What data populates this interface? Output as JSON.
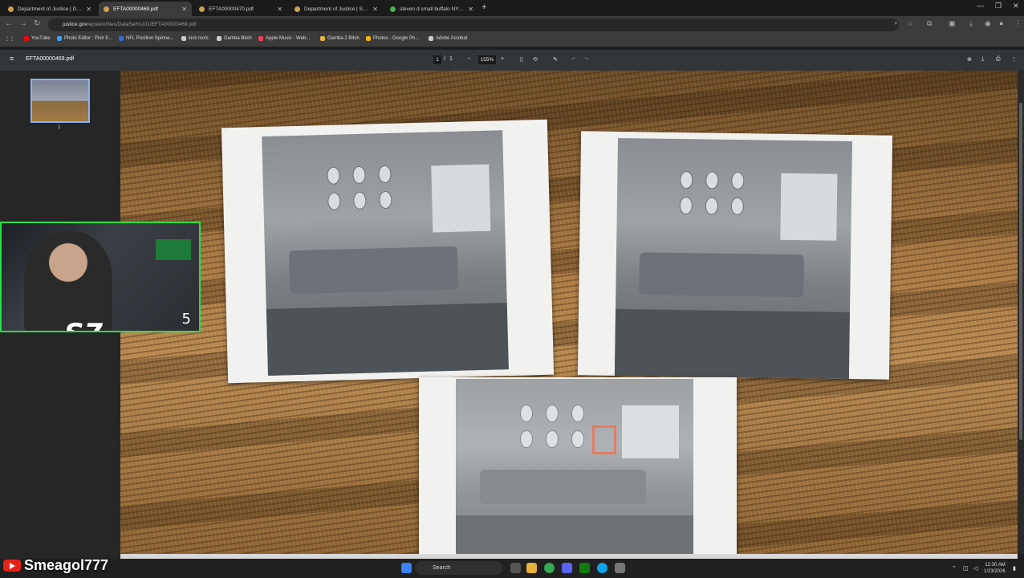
{
  "browser": {
    "tabs": [
      {
        "title": "Department of Justice | Data S",
        "active": false
      },
      {
        "title": "EFTA00000469.pdf",
        "active": true
      },
      {
        "title": "EFTA00000470.pdf",
        "active": false
      },
      {
        "title": "Department of Justice | Search",
        "active": false
      },
      {
        "title": "steven d small buffalo NY - G",
        "active": false
      }
    ],
    "url_host": "justice.gov",
    "url_path": "/epstein/files/DataSet%201/EFTA00000469.pdf",
    "bookmarks": [
      {
        "label": "YouTube",
        "color": "#ff0000"
      },
      {
        "label": "Photo Editor : Pixlr E...",
        "color": "#3aa0ff"
      },
      {
        "label": "NFL Position Spinne...",
        "color": "#3a6bd8"
      },
      {
        "label": "kick tools",
        "color": "#cccccc"
      },
      {
        "label": "Gamba Bitch",
        "color": "#cccccc"
      },
      {
        "label": "Apple Music - Web...",
        "color": "#fa3c5a"
      },
      {
        "label": "Gamba 2 Bitch",
        "color": "#e8b33a"
      },
      {
        "label": "Photos - Google Ph...",
        "color": "#f4b400"
      },
      {
        "label": "Adobe Acrobat",
        "color": "#cccccc"
      }
    ]
  },
  "pdf": {
    "filename": "EFTA00000469.pdf",
    "page_current": "1",
    "page_sep": "/",
    "page_total": "1",
    "zoom": "155%",
    "zoom_out": "−",
    "zoom_in": "+",
    "thumb_label": "1"
  },
  "overlay": {
    "cam_number": "5",
    "channel_name": "Smeagol777"
  },
  "taskbar": {
    "search_placeholder": "Search",
    "time": "12:30 AM",
    "date": "1/23/2026"
  }
}
